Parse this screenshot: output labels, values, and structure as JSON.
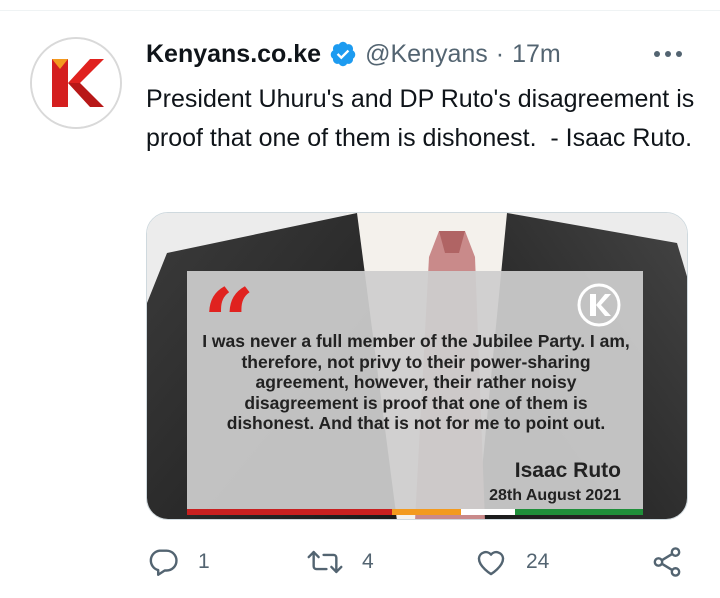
{
  "account": {
    "display_name": "Kenyans.co.ke",
    "handle": "@Kenyans",
    "separator": "·",
    "time": "17m",
    "avatar_letter": "K",
    "verified": true,
    "brand_red": "#e0221f",
    "verified_blue": "#1d9bf0"
  },
  "tweet": {
    "text": "President Uhuru's and DP Ruto's disagreement is proof that one of them is dishonest.  - Isaac Ruto."
  },
  "media": {
    "quote_mark": "“",
    "quote": "I was never a full member of the Jubilee Party. I am, therefore, not privy to their power-sharing agreement, however, their rather noisy disagreement is proof that one of them is dishonest. And that is not for me to point out.",
    "author": "Isaac Ruto",
    "date": "28th August 2021",
    "logo_letter": "K"
  },
  "actions": {
    "reply_count": "1",
    "retweet_count": "4",
    "like_count": "24"
  },
  "icons": {
    "more": "more-horizontal-icon",
    "reply": "reply-icon",
    "retweet": "retweet-icon",
    "like": "heart-icon",
    "share": "share-icon",
    "verified": "verified-badge-icon"
  },
  "colors": {
    "text_primary": "#0f1419",
    "text_secondary": "#536471",
    "strip": [
      "#c82020",
      "#f39a1e",
      "#ffffff",
      "#1f8f3a"
    ]
  }
}
